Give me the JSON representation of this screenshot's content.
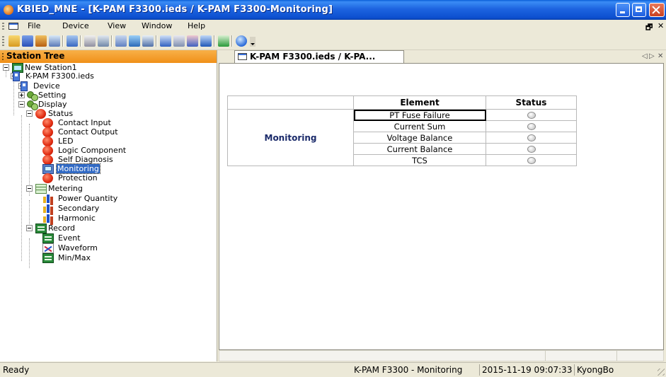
{
  "window": {
    "title": "KBIED_MNE - [K-PAM F3300.ieds / K-PAM F3300-Monitoring]"
  },
  "menu": {
    "items": [
      {
        "label": "File"
      },
      {
        "label": "Device"
      },
      {
        "label": "View"
      },
      {
        "label": "Window"
      },
      {
        "label": "Help"
      }
    ],
    "mdi_restore": "🗗",
    "mdi_close": "✕"
  },
  "toolbar": {
    "buttons": [
      "open-icon",
      "save-icon",
      "save-all-icon",
      "print-icon",
      "device-icon",
      "connect-icon",
      "upload-icon",
      "settings-icon",
      "monitor-icon",
      "grid-icon",
      "chart-icon",
      "chart2-icon",
      "transfer-icon",
      "delete-icon",
      "help-icon"
    ]
  },
  "station_tree": {
    "header": "Station Tree",
    "nodes": {
      "station": "New Station1",
      "ied": "K-PAM F3300.ieds",
      "device": "Device",
      "setting": "Setting",
      "display": "Display",
      "status": "Status",
      "contact_input": "Contact Input",
      "contact_output": "Contact Output",
      "led": "LED",
      "logic_component": "Logic Component",
      "self_diagnosis": "Self Diagnosis",
      "monitoring": "Monitoring",
      "protection": "Protection",
      "metering": "Metering",
      "power_quantity": "Power Quantity",
      "secondary": "Secondary",
      "harmonic": "Harmonic",
      "record": "Record",
      "event": "Event",
      "waveform": "Waveform",
      "min_max": "Min/Max"
    },
    "selected": "Monitoring"
  },
  "document": {
    "tab_label": "K-PAM F3300.ieds / K-PA...",
    "tab_nav_prev": "◁",
    "tab_nav_next": "▷",
    "tab_close": "✕",
    "table": {
      "headers": {
        "blank": "",
        "element": "Element",
        "status": "Status"
      },
      "group": "Monitoring",
      "rows": [
        {
          "element": "PT Fuse Failure",
          "status": "off"
        },
        {
          "element": "Current Sum",
          "status": "off"
        },
        {
          "element": "Voltage Balance",
          "status": "off"
        },
        {
          "element": "Current Balance",
          "status": "off"
        },
        {
          "element": "TCS",
          "status": "off"
        }
      ]
    }
  },
  "statusbar": {
    "ready": "Ready",
    "view": "K-PAM F3300 - Monitoring",
    "datetime": "2015-11-19 09:07:33",
    "user": "KyongBo"
  },
  "colors": {
    "titlebar": "#0c4fcf",
    "tree_header": "#f09018",
    "selection": "#316ac5",
    "group_text": "#1a2a6a"
  }
}
